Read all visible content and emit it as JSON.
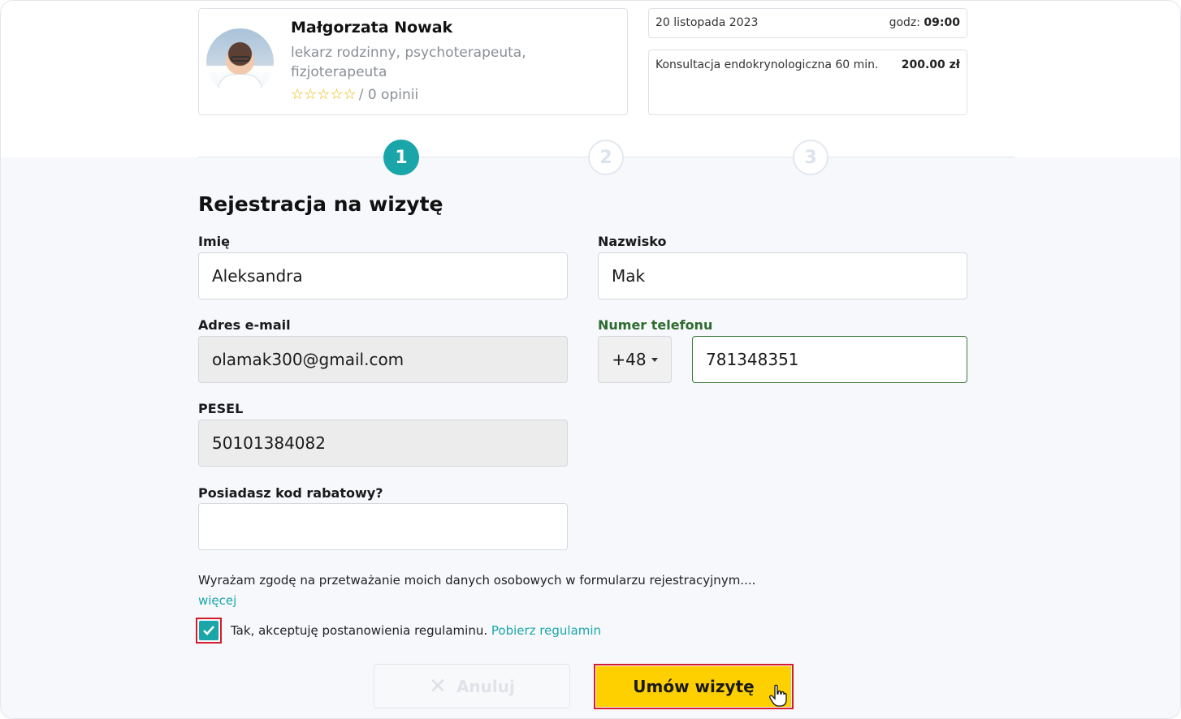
{
  "doctor": {
    "name": "Małgorzata Nowak",
    "specialization": "lekarz rodzinny, psychoterapeuta, fizjoterapeuta",
    "stars": "☆☆☆☆☆",
    "reviews": "/ 0 opinii"
  },
  "appointment": {
    "date": "20 listopada 2023",
    "time_label": "godz:",
    "time": "09:00",
    "service": "Konsultacja endokrynologiczna 60 min.",
    "price": "200.00 zł"
  },
  "steps": [
    "1",
    "2",
    "3"
  ],
  "form": {
    "title": "Rejestracja na wizytę",
    "first_name_label": "Imię",
    "first_name_value": "Aleksandra",
    "last_name_label": "Nazwisko",
    "last_name_value": "Mak",
    "email_label": "Adres e-mail",
    "email_value": "olamak300@gmail.com",
    "phone_label": "Numer telefonu",
    "phone_prefix": "+48",
    "phone_value": "781348351",
    "pesel_label": "PESEL",
    "pesel_value": "50101384082",
    "discount_label": "Posiadasz kod rabatowy?",
    "discount_value": "",
    "consent_text": "Wyrażam zgodę na przetważanie moich danych osobowych w formularzu rejestracyjnym....",
    "more_link": "więcej",
    "terms_text": "Tak, akceptuję postanowienia regulaminu.",
    "terms_link": "Pobierz regulamin",
    "terms_checked": true
  },
  "buttons": {
    "cancel": "Anuluj",
    "submit": "Umów wizytę"
  },
  "colors": {
    "accent": "#1aa6a8",
    "submit": "#ffd000",
    "highlight": "#d61c2a"
  }
}
